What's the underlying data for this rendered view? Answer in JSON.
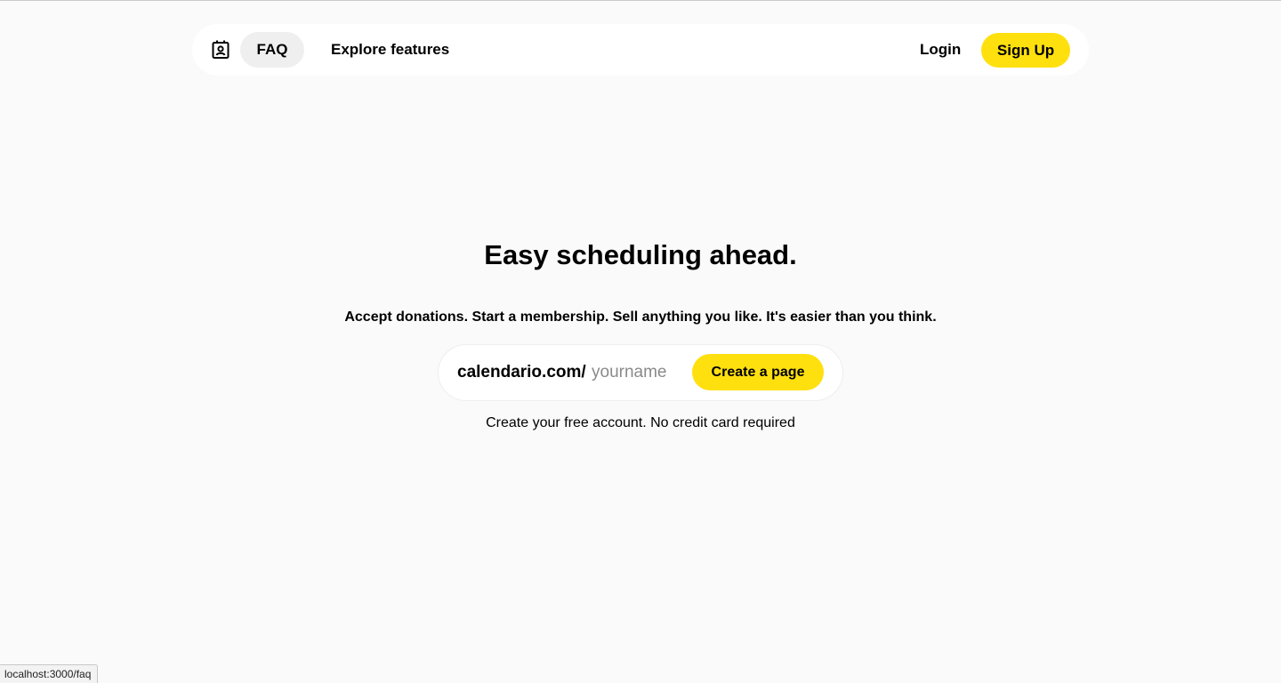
{
  "nav": {
    "logo_icon": "contact-card-icon",
    "faq_label": "FAQ",
    "explore_label": "Explore features",
    "login_label": "Login",
    "signup_label": "Sign Up"
  },
  "hero": {
    "title": "Easy scheduling ahead.",
    "subtitle": "Accept donations. Start a membership. Sell anything you like. It's easier than you think."
  },
  "claim": {
    "prefix": "calendario.com/",
    "input_value": "",
    "placeholder": "yourname",
    "button_label": "Create a page",
    "note": "Create your free account. No credit card required"
  },
  "status_bar": {
    "url": "localhost:3000/faq"
  },
  "colors": {
    "accent": "#ffe00f",
    "background": "#fafafa",
    "nav_active": "#efefef"
  }
}
